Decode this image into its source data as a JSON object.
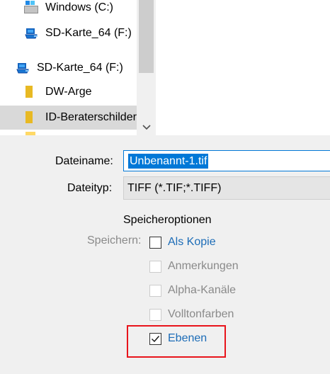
{
  "nav": {
    "items": [
      {
        "label": "Windows (C:)",
        "icon": "drive-icon"
      },
      {
        "label": "SD-Karte_64 (F:)",
        "icon": "usb-drive-icon"
      },
      {
        "label": "SD-Karte_64 (F:)",
        "icon": "usb-drive-icon"
      },
      {
        "label": "DW-Arge",
        "icon": "folder-icon"
      },
      {
        "label": "ID-Beraterschilder",
        "icon": "folder-icon",
        "selected": true
      }
    ]
  },
  "form": {
    "filename_label": "Dateiname:",
    "filename_value": "Unbenannt-1.tif",
    "filetype_label": "Dateityp:",
    "filetype_value": "TIFF (*.TIF;*.TIFF)"
  },
  "options": {
    "title": "Speicheroptionen",
    "save_label": "Speichern:",
    "items": [
      {
        "label": "Als Kopie",
        "checked": false,
        "enabled": true
      },
      {
        "label": "Anmerkungen",
        "checked": false,
        "enabled": false
      },
      {
        "label": "Alpha-Kanäle",
        "checked": false,
        "enabled": false
      },
      {
        "label": "Volltonfarben",
        "checked": false,
        "enabled": false
      },
      {
        "label": "Ebenen",
        "checked": true,
        "enabled": true
      }
    ]
  },
  "colors": {
    "accent": "#0078d7",
    "link_blue": "#1c6cb7",
    "highlight_red": "#e8141b",
    "disabled_text": "#8a8a8a"
  }
}
